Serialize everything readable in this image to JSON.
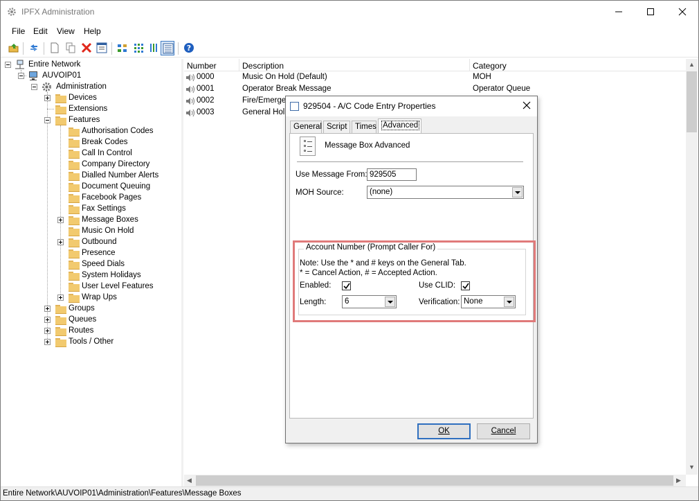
{
  "window": {
    "title": "IPFX Administration"
  },
  "menu": [
    "File",
    "Edit",
    "View",
    "Help"
  ],
  "toolbar_icons": [
    "open-folder-icon",
    "refresh-icon",
    "new-icon",
    "copy-icon",
    "delete-icon",
    "properties-icon",
    "large-icons-view-icon",
    "small-icons-view-icon",
    "list-view-icon",
    "details-view-icon",
    "help-icon"
  ],
  "tree": {
    "root": "Entire Network",
    "server": "AUVOIP01",
    "admin": "Administration",
    "level1": [
      "Devices",
      "Extensions",
      "Features"
    ],
    "features": [
      "Authorisation Codes",
      "Break Codes",
      "Call In Control",
      "Company Directory",
      "Dialled Number Alerts",
      "Document Queuing",
      "Facebook Pages",
      "Fax Settings",
      "Message Boxes",
      "Music On Hold",
      "Outbound",
      "Presence",
      "Speed Dials",
      "System Holidays",
      "User Level Features",
      "Wrap Ups"
    ],
    "level1_after": [
      "Groups",
      "Queues",
      "Routes",
      "Tools / Other"
    ]
  },
  "list": {
    "columns": [
      "Number",
      "Description",
      "Category"
    ],
    "rows": [
      {
        "number": "0000",
        "description": "Music On Hold (Default)",
        "category": "MOH"
      },
      {
        "number": "0001",
        "description": "Operator Break Message",
        "category": "Operator Queue"
      },
      {
        "number": "0002",
        "description": "Fire/Emergen",
        "category": ""
      },
      {
        "number": "0003",
        "description": "General Holid",
        "category": ""
      }
    ]
  },
  "status": {
    "path": "Entire Network\\AUVOIP01\\Administration\\Features\\Message Boxes"
  },
  "dialog": {
    "title": "929504 - A/C Code Entry Properties",
    "tabs": [
      "General",
      "Script",
      "Times",
      "Advanced"
    ],
    "active_tab": "Advanced",
    "heading": "Message Box Advanced",
    "use_message_from_label": "Use Message From:",
    "use_message_from_value": "929505",
    "moh_source_label": "MOH Source:",
    "moh_source_value": "(none)",
    "group_title": "Account Number  (Prompt Caller For)",
    "note_line1": "Note: Use the * and # keys on the General Tab.",
    "note_line2": "* = Cancel Action,   # = Accepted Action.",
    "enabled_label": "Enabled:",
    "enabled_checked": true,
    "use_clid_label": "Use CLID:",
    "use_clid_checked": true,
    "length_label": "Length:",
    "length_value": "6",
    "verification_label": "Verification:",
    "verification_value": "None",
    "ok_label": "OK",
    "cancel_label": "Cancel"
  },
  "colors": {
    "highlight": "#e07a7a",
    "folder": "#f2ca6f",
    "accent": "#2f6fbf"
  }
}
